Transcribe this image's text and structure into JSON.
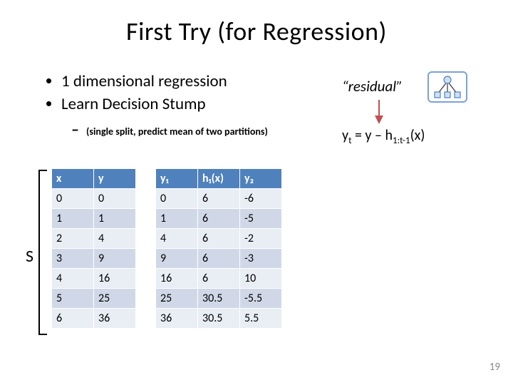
{
  "title": "First Try (for Regression)",
  "bullets": {
    "b1": "1 dimensional regression",
    "b2": "Learn Decision Stump",
    "sub_dash": "–",
    "sub_paren": "(single split, predict mean of two partitions)"
  },
  "residual_label": "“residual”",
  "equation": {
    "lhs": "y",
    "lhs_sub": "t",
    "eq": " = y – h",
    "h_sub": "1:t-1",
    "tail": "(x)"
  },
  "s_label": "S",
  "table1": {
    "headers": [
      "x",
      "y"
    ],
    "rows": [
      [
        "0",
        "0"
      ],
      [
        "1",
        "1"
      ],
      [
        "2",
        "4"
      ],
      [
        "3",
        "9"
      ],
      [
        "4",
        "16"
      ],
      [
        "5",
        "25"
      ],
      [
        "6",
        "36"
      ]
    ]
  },
  "table2": {
    "headers": [
      "y₁",
      "h₁(x)",
      "y₂"
    ],
    "rows": [
      [
        "0",
        "6",
        "-6"
      ],
      [
        "1",
        "6",
        "-5"
      ],
      [
        "4",
        "6",
        "-2"
      ],
      [
        "9",
        "6",
        "-3"
      ],
      [
        "16",
        "6",
        "10"
      ],
      [
        "25",
        "30.5",
        "-5.5"
      ],
      [
        "36",
        "30.5",
        "5.5"
      ]
    ]
  },
  "pagenum": "19",
  "chart_data": {
    "type": "table",
    "title": "First Try (for Regression) — decision stump residuals",
    "tables": [
      {
        "name": "S",
        "columns": [
          "x",
          "y"
        ],
        "rows": [
          [
            0,
            0
          ],
          [
            1,
            1
          ],
          [
            2,
            4
          ],
          [
            3,
            9
          ],
          [
            4,
            16
          ],
          [
            5,
            25
          ],
          [
            6,
            36
          ]
        ]
      },
      {
        "name": "residuals",
        "columns": [
          "y1",
          "h1(x)",
          "y2"
        ],
        "rows": [
          [
            0,
            6,
            -6
          ],
          [
            1,
            6,
            -5
          ],
          [
            4,
            6,
            -2
          ],
          [
            9,
            6,
            -3
          ],
          [
            16,
            6,
            10
          ],
          [
            25,
            30.5,
            -5.5
          ],
          [
            36,
            30.5,
            5.5
          ]
        ]
      }
    ]
  }
}
